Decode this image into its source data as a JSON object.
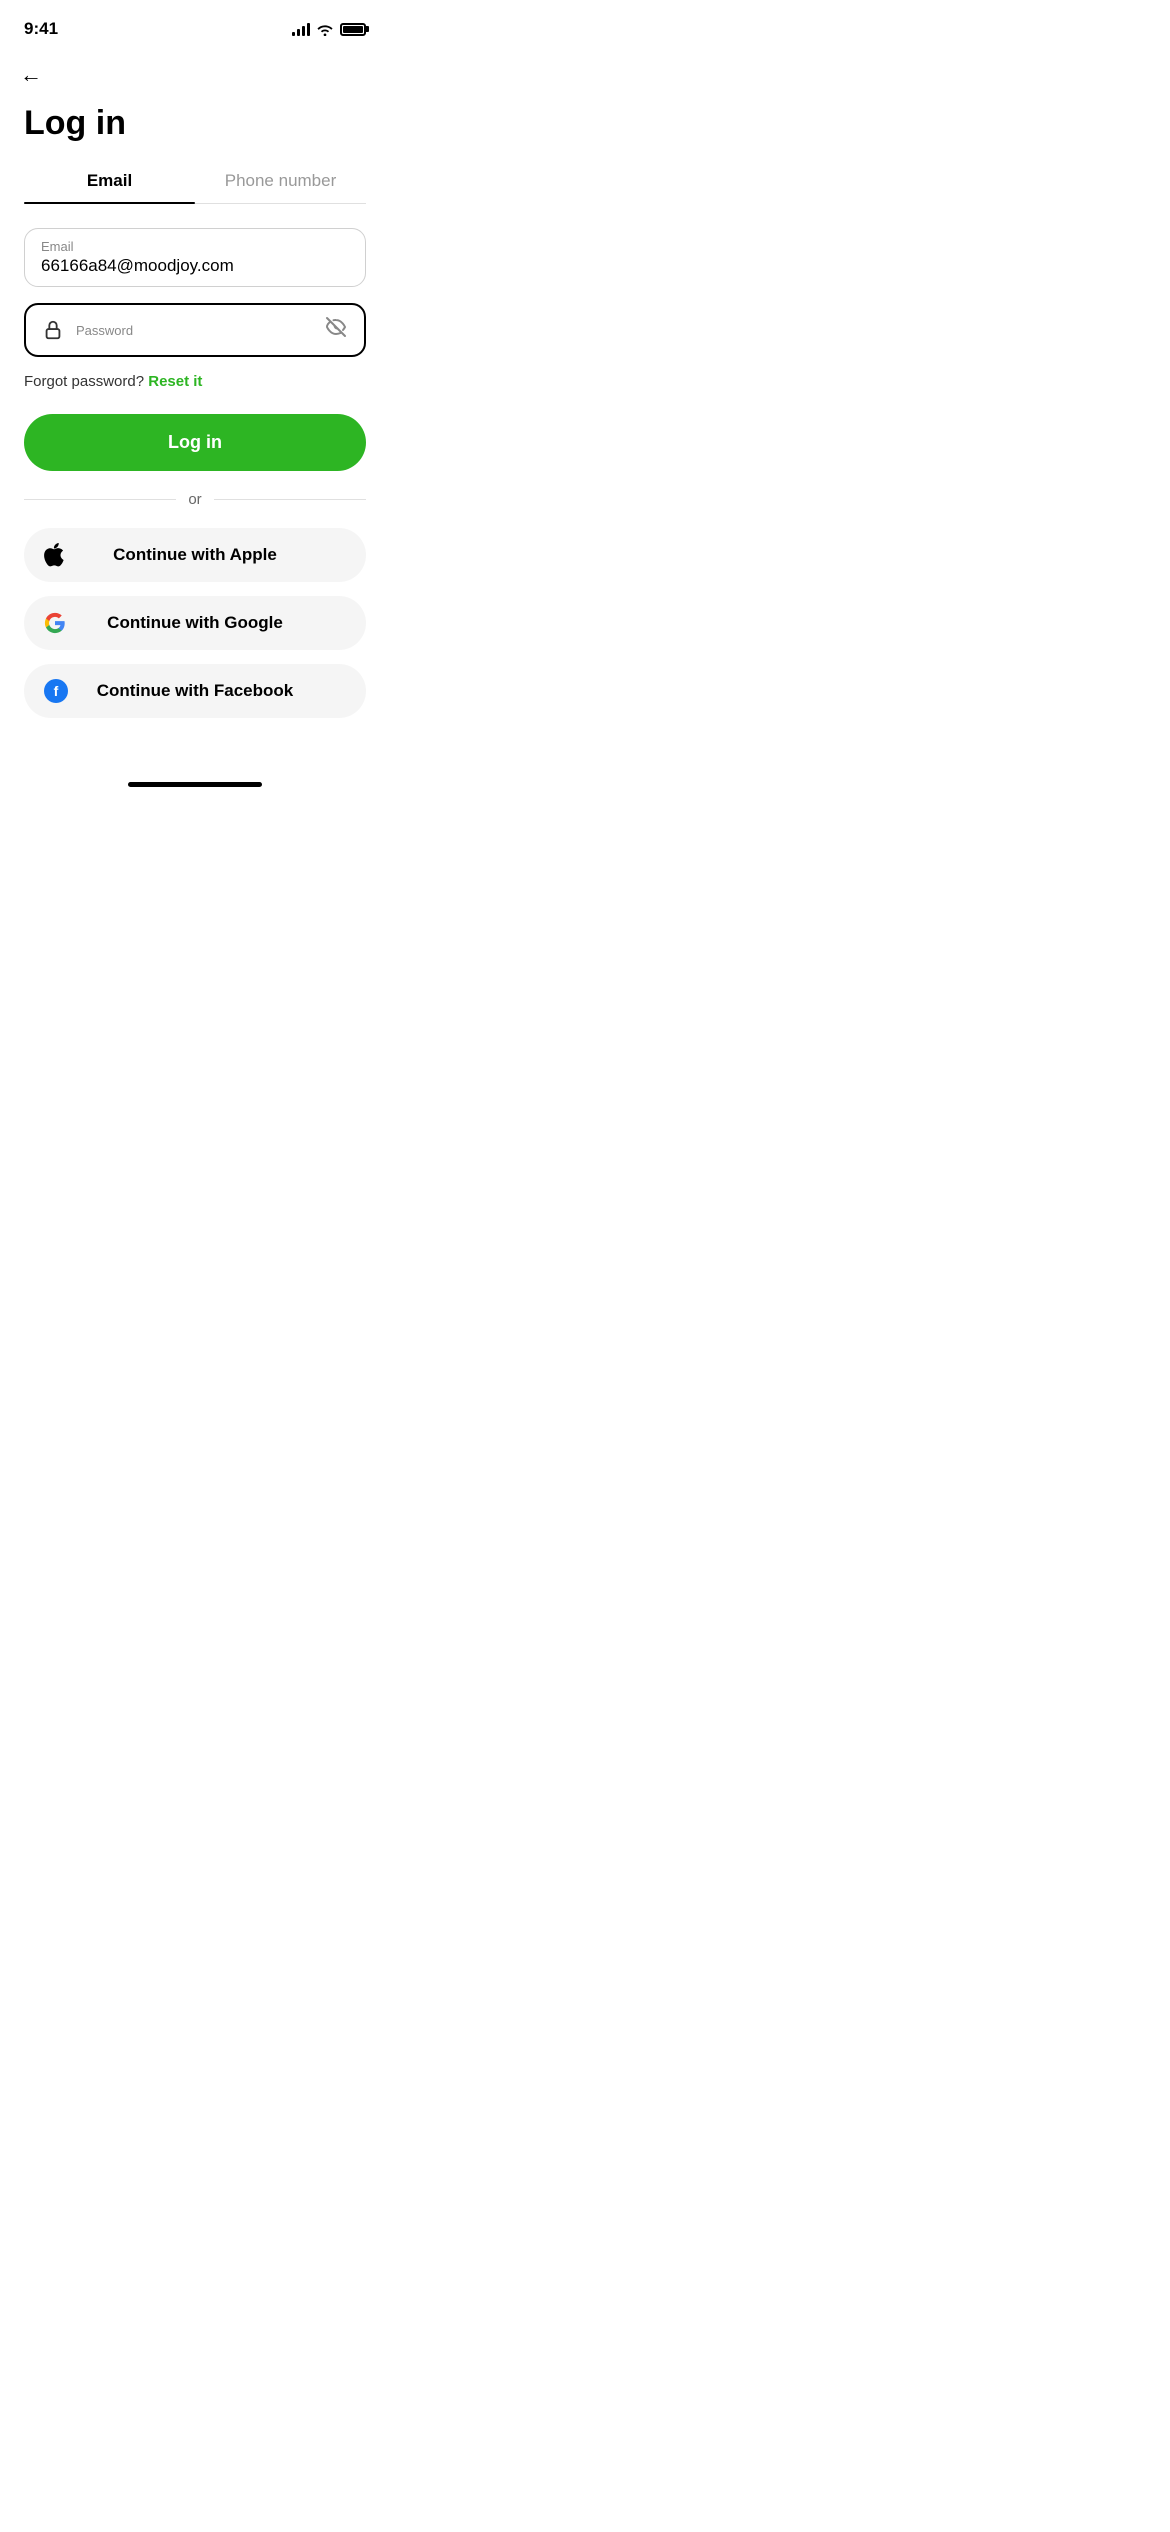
{
  "statusBar": {
    "time": "9:41"
  },
  "header": {
    "backLabel": "←",
    "title": "Log in"
  },
  "tabs": [
    {
      "id": "email",
      "label": "Email",
      "active": true
    },
    {
      "id": "phone",
      "label": "Phone number",
      "active": false
    }
  ],
  "form": {
    "emailField": {
      "label": "Email",
      "value": "66166a84@moodjoy.com"
    },
    "passwordField": {
      "label": "Password"
    },
    "forgotPasswordText": "Forgot password?",
    "resetLinkText": "Reset it",
    "loginButtonLabel": "Log in"
  },
  "divider": {
    "text": "or"
  },
  "socialButtons": [
    {
      "id": "apple",
      "label": "Continue with Apple"
    },
    {
      "id": "google",
      "label": "Continue with Google"
    },
    {
      "id": "facebook",
      "label": "Continue with Facebook"
    }
  ]
}
